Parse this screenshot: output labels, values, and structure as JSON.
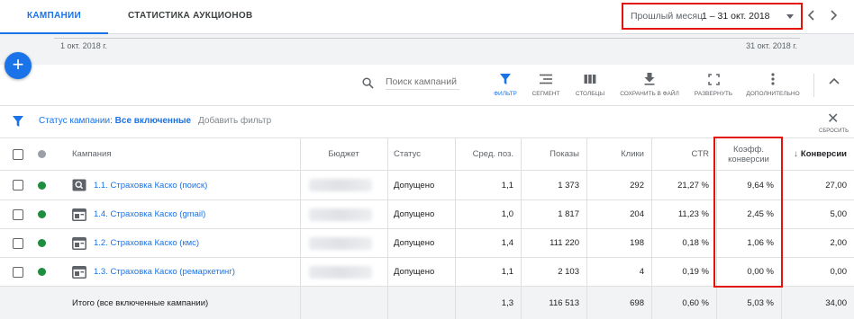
{
  "tabs": {
    "campaigns": "КАМПАНИИ",
    "auction": "СТАТИСТИКА АУКЦИОНОВ"
  },
  "date": {
    "label": "Прошлый месяц",
    "range": "1 – 31 окт. 2018"
  },
  "timeline": {
    "start": "1 окт. 2018 г.",
    "end": "31 окт. 2018 г."
  },
  "fab": "+",
  "search": {
    "placeholder": "Поиск кампаний"
  },
  "toolbar": {
    "filter": "ФИЛЬТР",
    "segment": "СЕГМЕНТ",
    "columns": "СТОЛБЦЫ",
    "download": "СОХРАНИТЬ В ФАЙЛ",
    "expand": "РАЗВЕРНУТЬ",
    "more": "ДОПОЛНИТЕЛЬНО"
  },
  "filter": {
    "label": "Статус кампании:",
    "value": "Все включенные",
    "add": "Добавить фильтр",
    "reset": "СБРОСИТЬ"
  },
  "table": {
    "headers": {
      "campaign": "Кампания",
      "budget": "Бюджет",
      "status": "Статус",
      "avg_pos": "Сред. поз.",
      "impressions": "Показы",
      "clicks": "Клики",
      "ctr": "CTR",
      "conv_rate_1": "Коэфф.",
      "conv_rate_2": "конверсии",
      "conversions": "Конверсии"
    },
    "rows": [
      {
        "name": "1.1. Страховка Каско (поиск)",
        "icon": "search-campaign-icon",
        "status": "Допущено",
        "avg_pos": "1,1",
        "impressions": "1 373",
        "clicks": "292",
        "ctr": "21,27 %",
        "conv_rate": "9,64 %",
        "conversions": "27,00"
      },
      {
        "name": "1.4. Страховка Каско (gmail)",
        "icon": "display-campaign-icon",
        "status": "Допущено",
        "avg_pos": "1,0",
        "impressions": "1 817",
        "clicks": "204",
        "ctr": "11,23 %",
        "conv_rate": "2,45 %",
        "conversions": "5,00"
      },
      {
        "name": "1.2. Страховка Каско (кмс)",
        "icon": "display-campaign-icon",
        "status": "Допущено",
        "avg_pos": "1,4",
        "impressions": "111 220",
        "clicks": "198",
        "ctr": "0,18 %",
        "conv_rate": "1,06 %",
        "conversions": "2,00"
      },
      {
        "name": "1.3. Страховка Каско (ремаркетинг)",
        "icon": "display-campaign-icon",
        "status": "Допущено",
        "avg_pos": "1,1",
        "impressions": "2 103",
        "clicks": "4",
        "ctr": "0,19 %",
        "conv_rate": "0,00 %",
        "conversions": "0,00"
      }
    ],
    "total": {
      "label": "Итого (все включенные кампании)",
      "avg_pos": "1,3",
      "impressions": "116 513",
      "clicks": "698",
      "ctr": "0,60 %",
      "conv_rate": "5,03 %",
      "conversions": "34,00"
    }
  },
  "colors": {
    "accent": "#1a73e8",
    "highlight_box": "#e3120b",
    "enabled": "#1e8e3e"
  }
}
